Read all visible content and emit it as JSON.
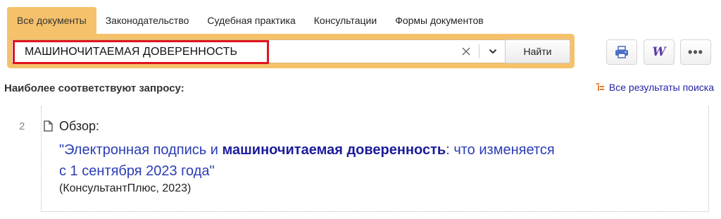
{
  "tabs": [
    {
      "label": "Все документы",
      "active": true
    },
    {
      "label": "Законодательство",
      "active": false
    },
    {
      "label": "Судебная практика",
      "active": false
    },
    {
      "label": "Консультации",
      "active": false
    },
    {
      "label": "Формы документов",
      "active": false
    }
  ],
  "search": {
    "value": "МАШИНОЧИТАЕМАЯ ДОВЕРЕННОСТЬ",
    "find_label": "Найти",
    "clear_icon": "close-icon",
    "dropdown_icon": "chevron-down-icon"
  },
  "toolbar": {
    "print_icon": "printer-icon",
    "word_icon": "word-export-icon",
    "word_glyph": "W",
    "more_icon": "more-icon",
    "more_glyph": "•••"
  },
  "section": {
    "title": "Наиболее соответствуют запросу:",
    "all_results_label": "Все результаты поиска"
  },
  "results": [
    {
      "number": "2",
      "type": "Обзор:",
      "title_before": "\"Электронная подпись и ",
      "title_highlight": "машиночитаемая доверенность",
      "title_line1_after": ": что изменяется",
      "title_line2": "с 1 сентября 2023 года\"",
      "source": "(КонсультантПлюс, 2023)"
    }
  ],
  "colors": {
    "accent": "#f5c26b",
    "highlight_border": "#e0141e",
    "link": "#2b3cb5",
    "link_bold": "#1c1c9b"
  }
}
